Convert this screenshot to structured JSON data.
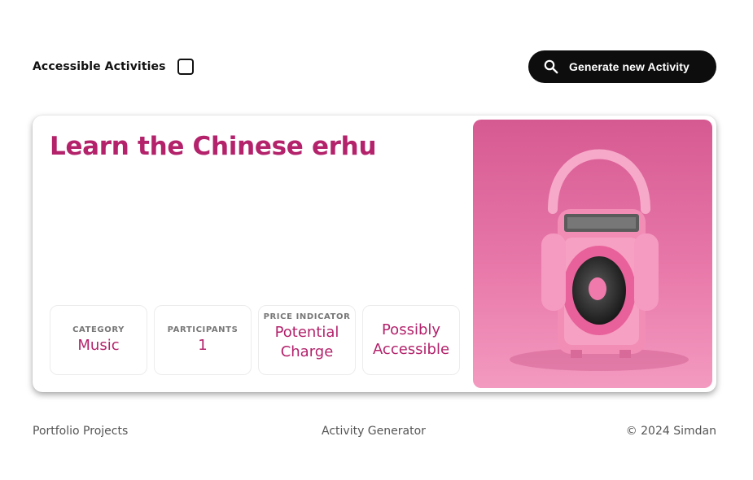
{
  "header": {
    "accessible_label": "Accessible Activities",
    "accessible_checked": false,
    "generate_label": "Generate new Activity"
  },
  "activity": {
    "title": "Learn the Chinese erhu",
    "image_subject": "pink radio with headphones",
    "chips": [
      {
        "caption": "Category",
        "value": "Music"
      },
      {
        "caption": "Participants",
        "value": "1"
      },
      {
        "caption": "Price Indicator",
        "value": "Potential Charge"
      },
      {
        "caption": "",
        "value": "Possibly Accessible"
      }
    ]
  },
  "footer": {
    "left": "Portfolio Projects",
    "center": "Activity Generator",
    "right": "© 2024 Simdan"
  },
  "colors": {
    "accent": "#b3226b",
    "button_bg": "#0d0d0d",
    "image_pink": "#e878a9"
  },
  "icons": {
    "search": "search-icon"
  }
}
